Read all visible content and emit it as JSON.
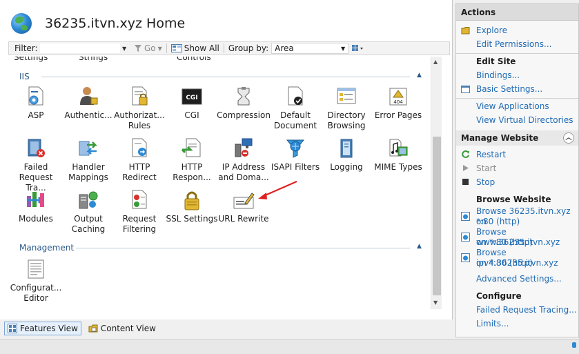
{
  "page": {
    "title": "36235.itvn.xyz Home"
  },
  "toolbar": {
    "filter_label": "Filter:",
    "go_label": "Go",
    "show_all_label": "Show All",
    "group_by_label": "Group by:",
    "group_by_value": "Area"
  },
  "cutoff": [
    "Settings",
    "Strings",
    "Controls"
  ],
  "sections": {
    "iis": "IIS",
    "management": "Management"
  },
  "features": [
    "ASP",
    "Authentic...",
    "Authorizat... Rules",
    "CGI",
    "Compression",
    "Default Document",
    "Directory Browsing",
    "Error Pages",
    "Failed Request Tra...",
    "Handler Mappings",
    "HTTP Redirect",
    "HTTP Respon...",
    "IP Address and Doma...",
    "ISAPI Filters",
    "Logging",
    "MIME Types",
    "Modules",
    "Output Caching",
    "Request Filtering",
    "SSL Settings",
    "URL Rewrite",
    "Configurat... Editor"
  ],
  "view_tabs": [
    "Features View",
    "Content View"
  ],
  "actions": {
    "header": "Actions",
    "explore": "Explore",
    "edit_permissions": "Edit Permissions...",
    "edit_site": "Edit Site",
    "bindings": "Bindings...",
    "basic_settings": "Basic Settings...",
    "view_applications": "View Applications",
    "view_virtual_directories": "View Virtual Directories",
    "manage_website": "Manage Website",
    "restart": "Restart",
    "start": "Start",
    "stop": "Stop",
    "browse_website": "Browse Website",
    "browse_1_line1": "Browse 36235.itvn.xyz on",
    "browse_1_line2": "*:80 (http)",
    "browse_2_line1": "Browse www.36235.itvn.xyz",
    "browse_2_line2": "on *:80 (http)",
    "browse_3_line1": "Browse ipv4.36235.itvn.xyz",
    "browse_3_line2": "on *:80 (http)",
    "advanced_settings": "Advanced Settings...",
    "configure": "Configure",
    "failed_request_tracing": "Failed Request Tracing...",
    "limits": "Limits..."
  }
}
